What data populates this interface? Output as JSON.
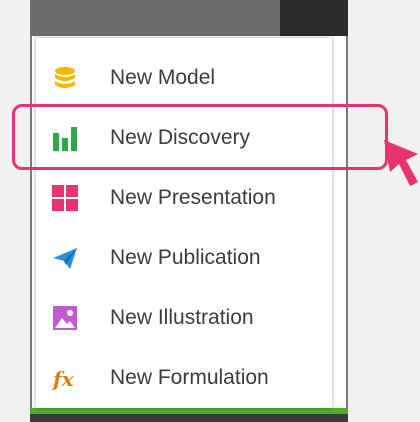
{
  "menu": {
    "items": [
      {
        "label": "New Model",
        "icon": "database-icon",
        "color": "#f5b800"
      },
      {
        "label": "New Discovery",
        "icon": "bar-chart-icon",
        "color": "#2ea84a"
      },
      {
        "label": "New Presentation",
        "icon": "grid-icon",
        "color": "#e8336e"
      },
      {
        "label": "New Publication",
        "icon": "paper-plane-icon",
        "color": "#2a8ee0"
      },
      {
        "label": "New Illustration",
        "icon": "image-icon",
        "color": "#c45ad0"
      },
      {
        "label": "New Formulation",
        "icon": "fx-icon",
        "color": "#e07a10"
      }
    ]
  },
  "fx_glyph": "fx",
  "colors": {
    "highlight": "#e8336e",
    "topbar": "#6d6d6d",
    "bottom_accent": "#4caf2a"
  }
}
